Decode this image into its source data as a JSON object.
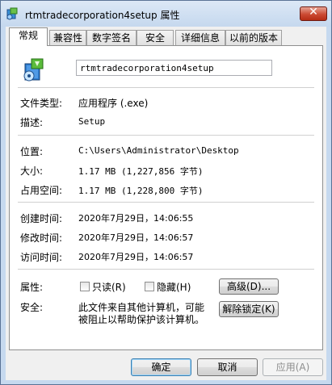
{
  "window": {
    "title": "rtmtradecorporation4setup 属性"
  },
  "tabs": [
    {
      "label": "常规"
    },
    {
      "label": "兼容性"
    },
    {
      "label": "数字签名"
    },
    {
      "label": "安全"
    },
    {
      "label": "详细信息"
    },
    {
      "label": "以前的版本"
    }
  ],
  "general": {
    "file_name": "rtmtradecorporation4setup",
    "rows": [
      {
        "label": "文件类型:",
        "value": "应用程序 (.exe)"
      },
      {
        "label": "描述:",
        "value": "Setup"
      },
      {
        "label": "位置:",
        "value": "C:\\Users\\Administrator\\Desktop"
      },
      {
        "label": "大小:",
        "value": "1.17 MB (1,227,856 字节)"
      },
      {
        "label": "占用空间:",
        "value": "1.17 MB (1,228,800 字节)"
      },
      {
        "label": "创建时间:",
        "value": "2020年7月29日，14:06:55"
      },
      {
        "label": "修改时间:",
        "value": "2020年7月29日，14:06:57"
      },
      {
        "label": "访问时间:",
        "value": "2020年7月29日，14:06:57"
      }
    ],
    "attributes_label": "属性:",
    "readonly_label": "只读(R)",
    "hidden_label": "隐藏(H)",
    "advanced_button": "高级(D)...",
    "security_label": "安全:",
    "security_text_line1": "此文件来自其他计算机，可能",
    "security_text_line2": "被阻止以帮助保护该计算机。",
    "unblock_button": "解除锁定(K)"
  },
  "footer": {
    "ok": "确定",
    "cancel": "取消",
    "apply": "应用(A)"
  }
}
